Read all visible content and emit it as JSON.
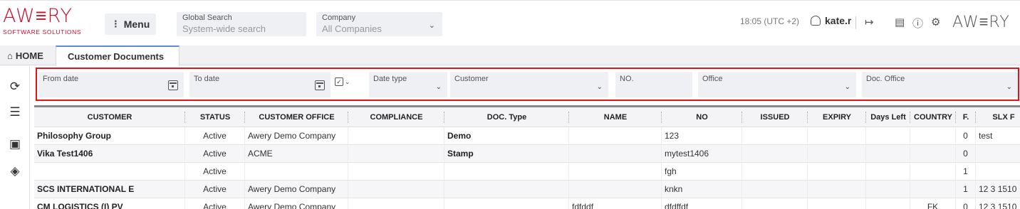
{
  "header": {
    "logo_main": "AW≡RY",
    "logo_sub": "SOFTWARE SOLUTIONS",
    "menu_label": "Menu",
    "global_search": {
      "label": "Global Search",
      "placeholder": "System-wide search"
    },
    "company": {
      "label": "Company",
      "value": "All Companies"
    },
    "time": "18:05 (UTC +2)",
    "user": "kate.r",
    "logo_right": "AW≡RY"
  },
  "tabs": {
    "home": "HOME",
    "active": "Customer Documents"
  },
  "filters": {
    "from_date": "From date",
    "to_date": "To date",
    "date_type": "Date type",
    "customer": "Customer",
    "no": "NO.",
    "office": "Office",
    "doc_office": "Doc. Office"
  },
  "table": {
    "columns": [
      "CUSTOMER",
      "STATUS",
      "CUSTOMER OFFICE",
      "COMPLIANCE",
      "DOC. Type",
      "NAME",
      "NO",
      "ISSUED",
      "EXPIRY",
      "Days Left",
      "COUNTRY",
      "F.",
      "SLX F"
    ],
    "rows": [
      {
        "customer": "Philosophy Group",
        "status": "Active",
        "office": "Awery Demo Company",
        "compliance": "",
        "doc_type": "Demo",
        "name": "",
        "no": "123",
        "issued": "",
        "expiry": "",
        "days_left": "",
        "country": "",
        "f": "0",
        "slx": "test"
      },
      {
        "customer": "Vika Test1406",
        "status": "Active",
        "office": "ACME",
        "compliance": "",
        "doc_type": "Stamp",
        "name": "",
        "no": "mytest1406",
        "issued": "",
        "expiry": "",
        "days_left": "",
        "country": "",
        "f": "0",
        "slx": ""
      },
      {
        "customer": "",
        "status": "Active",
        "office": "",
        "compliance": "",
        "doc_type": "",
        "name": "",
        "no": "fgh",
        "issued": "",
        "expiry": "",
        "days_left": "",
        "country": "",
        "f": "1",
        "slx": ""
      },
      {
        "customer": "SCS INTERNATIONAL E",
        "status": "Active",
        "office": "Awery Demo Company",
        "compliance": "",
        "doc_type": "",
        "name": "",
        "no": "knkn",
        "issued": "",
        "expiry": "",
        "days_left": "",
        "country": "",
        "f": "1",
        "slx": "12 3 1510"
      },
      {
        "customer": "CM LOGISTICS (I) PV",
        "status": "Active",
        "office": "Awery Demo Company",
        "compliance": "",
        "doc_type": "",
        "name": "fdfddf",
        "no": "dfdffdf",
        "issued": "",
        "expiry": "",
        "days_left": "",
        "country": "FK",
        "f": "0",
        "slx": "12 3 1510"
      }
    ]
  },
  "colors": {
    "brand": "#c8102e",
    "highlight": "#e8101a",
    "accent": "#5b8dd6"
  }
}
